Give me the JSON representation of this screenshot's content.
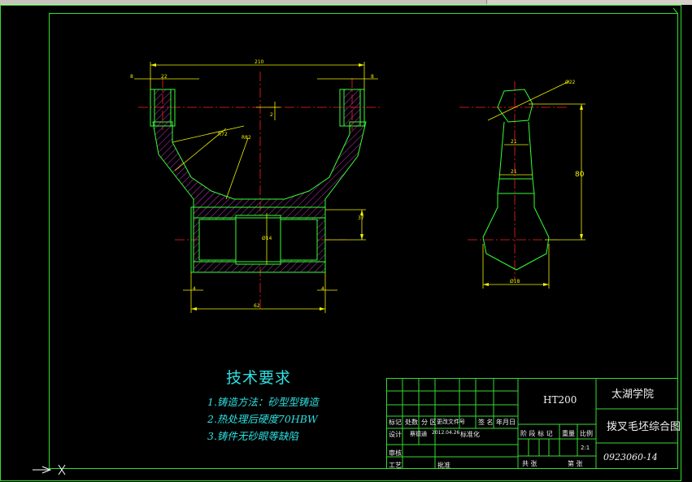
{
  "tech_requirements": {
    "title": "技术要求",
    "items": [
      "1.铸造方法：砂型型铸造",
      "2.热处理后硬度70HBW",
      "3.铸件无砂眼等缺陷"
    ]
  },
  "title_block": {
    "material": "HT200",
    "school": "太湖学院",
    "drawing_name": "拨叉毛坯综合图",
    "drawing_number": "0923060-14",
    "scale_value": "2:1",
    "labels": {
      "mark": "标记",
      "count": "处数",
      "zone": "分 区",
      "change_doc": "更改文件号",
      "signature": "签 名",
      "date": "年月日",
      "designer": "设计",
      "designer_name": "蔡德通",
      "design_date": "2012.04.26",
      "standardize": "标准化",
      "stage_mark": "阶 段 标 记",
      "weight": "重量",
      "scale": "比例",
      "review": "审核",
      "process": "工艺",
      "approve": "批准",
      "sheets_total": "共 张",
      "sheet_no": "第 张"
    }
  },
  "dimensions": {
    "top_width": "210",
    "left_small": "22",
    "left_gap": "8",
    "right_gap": "8",
    "center_gap": "2",
    "radius_1": "R72",
    "radius_2": "R82",
    "height_right": "37",
    "bore_dia": "Ø14",
    "bottom_width": "62",
    "bottom_left": "4",
    "bottom_right": "4",
    "side_dia": "Ø22",
    "side_height": "80",
    "side_width_1": "21",
    "side_width_2": "21",
    "side_bottom": "Ø18"
  },
  "colors": {
    "frame": "#33dd33",
    "outline": "#33ff33",
    "dimension": "#f0f000",
    "center_line": "#ff2020",
    "hatch": "#cc33cc",
    "text_cyan": "#2fe0e0",
    "table_line": "#33dd33"
  },
  "ucs_icon": "ucs-axis-icon"
}
